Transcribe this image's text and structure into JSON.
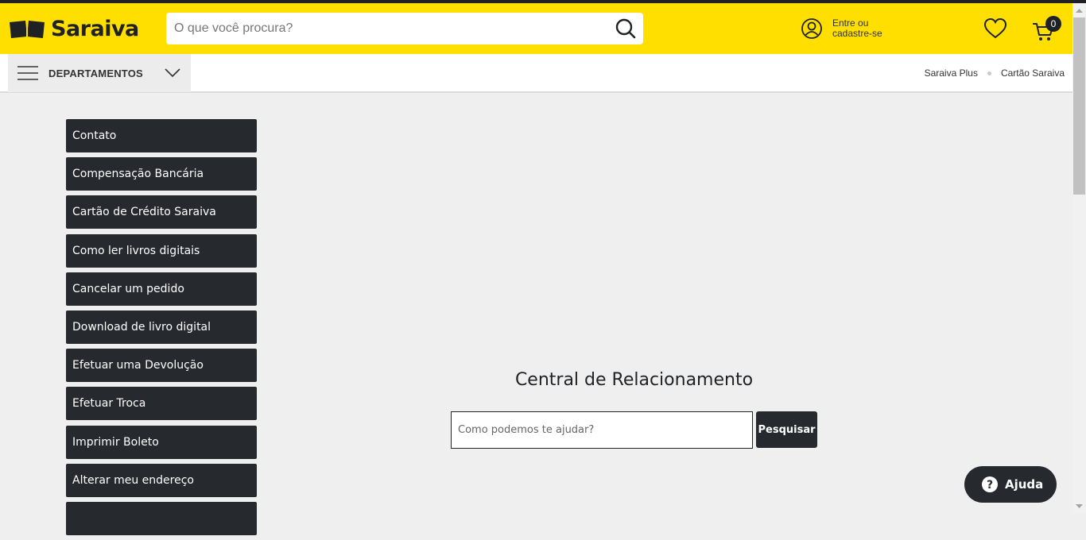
{
  "header": {
    "logo_text": "Saraiva",
    "search_placeholder": "O que você procura?",
    "account_line1": "Entre ou",
    "account_line2": "cadastre-se",
    "cart_count": "0",
    "brand_color": "#ffdf00"
  },
  "navbar": {
    "departments_label": "DEPARTAMENTOS",
    "links": [
      "Saraiva Plus",
      "Cartão Saraiva"
    ]
  },
  "sidemenu": {
    "items": [
      "Contato",
      "Compensação Bancária",
      "Cartão de Crédito Saraiva",
      "Como ler livros digitais",
      "Cancelar um pedido",
      "Download de livro digital",
      "Efetuar uma Devolução",
      "Efetuar Troca",
      "Imprimir Boleto",
      "Alterar meu endereço",
      ""
    ]
  },
  "main": {
    "title": "Central de Relacionamento",
    "help_placeholder": "Como podemos te ajudar?",
    "search_button": "Pesquisar"
  },
  "chat": {
    "label": "Ajuda"
  }
}
